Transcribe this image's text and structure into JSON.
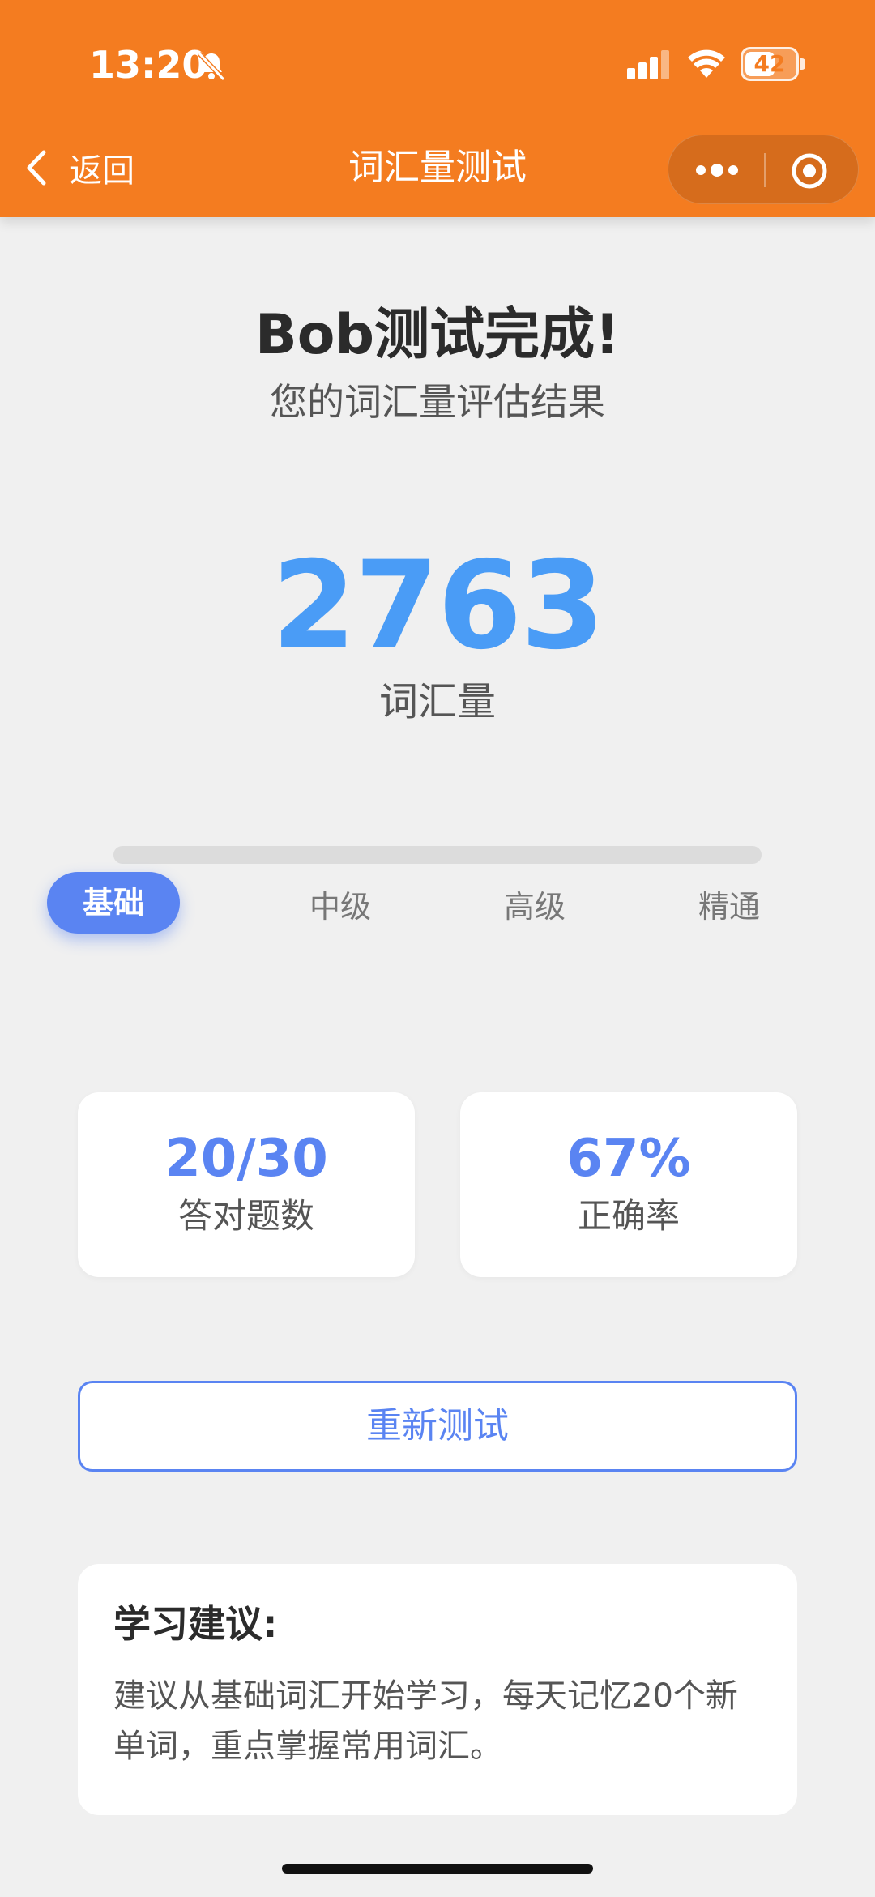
{
  "status_bar": {
    "time": "13:20",
    "battery": "42"
  },
  "nav": {
    "back_label": "返回",
    "title": "词汇量测试"
  },
  "result": {
    "title": "Bob测试完成!",
    "subtitle": "您的词汇量评估结果",
    "vocab_count": "2763",
    "vocab_label": "词汇量"
  },
  "level": {
    "current": "基础",
    "labels": [
      "基础",
      "中级",
      "高级",
      "精通"
    ],
    "progress": 0
  },
  "stats": [
    {
      "value": "20/30",
      "label": "答对题数"
    },
    {
      "value": "67%",
      "label": "正确率"
    }
  ],
  "retest_label": "重新测试",
  "advice": {
    "title": "学习建议:",
    "text": "建议从基础词汇开始学习，每天记忆20个新单词，重点掌握常用词汇。"
  },
  "colors": {
    "header": "#f47c20",
    "accent": "#5a84f2",
    "number": "#4a9cf6",
    "background": "#f0f0f0"
  }
}
